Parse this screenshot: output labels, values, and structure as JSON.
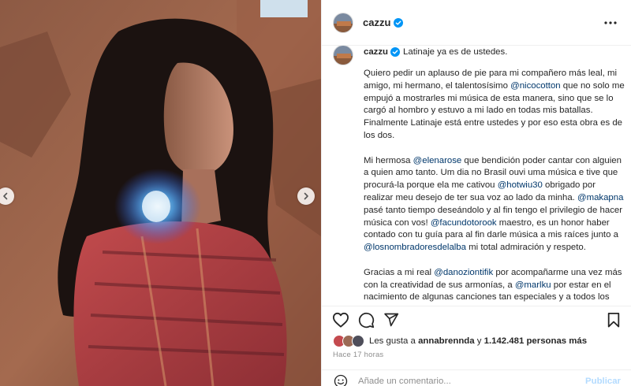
{
  "post": {
    "username": "cazzu",
    "verified": true,
    "caption_first_line": "Latinaje ya es de ustedes.",
    "caption_paragraphs": [
      [
        {
          "t": "Quiero pedir un aplauso de pie para mi compañero más leal, mi amigo, mi hermano, el talentosísimo "
        },
        {
          "m": "@nicocotton"
        },
        {
          "t": " que no solo me empujó a mostrarles mi música de esta manera, sino que se lo cargó al hombro y estuvo a mi lado en todas mis batallas. Finalmente Latinaje está entre ustedes y por eso esta obra es de los dos."
        }
      ],
      [
        {
          "t": "Mi hermosa "
        },
        {
          "m": "@elenarose"
        },
        {
          "t": " que bendición poder cantar con alguien a quien amo tanto. Um dia no Brasil ouvi uma música e tive que procurá-la porque ela me cativou "
        },
        {
          "m": "@hotwiu30"
        },
        {
          "t": " obrigado por realizar meu desejo de ter sua voz ao lado da minha. "
        },
        {
          "m": "@makapna"
        },
        {
          "t": " pasé tanto tiempo deseándolo y al fin tengo el privilegio de hacer música con vos! "
        },
        {
          "m": "@facundotorook"
        },
        {
          "t": " maestro, es un honor haber contado con tu guía para al fin darle música a mis raíces junto a "
        },
        {
          "m": "@losnombradoresdelalba"
        },
        {
          "t": " mi total admiración y respeto."
        }
      ],
      [
        {
          "t": "Gracias a mi real "
        },
        {
          "m": "@danoziontifik"
        },
        {
          "t": " por acompañarme una vez más con la creatividad de sus armonías, a "
        },
        {
          "m": "@marlku"
        },
        {
          "t": " por estar en el nacimiento de algunas canciones tan especiales y a todos los músicos que han formado parte de la construcción de Latinaje, un cariño inmenso!"
        }
      ]
    ],
    "likes": {
      "prefix": "Les gusta a ",
      "first_user": "annabrennda",
      "connector": " y ",
      "others": "1.142.481 personas más"
    },
    "time_ago": "Hace 17 horas",
    "comment_placeholder": "Añade un comentario...",
    "publish_label": "Publicar"
  },
  "icons": {
    "more": "more-options-icon",
    "like": "heart-icon",
    "comment": "comment-icon",
    "share": "share-icon",
    "save": "bookmark-icon",
    "emoji": "emoji-icon",
    "prev": "chevron-left-icon",
    "next": "chevron-right-icon",
    "verified": "verified-badge-icon"
  },
  "colors": {
    "mention": "#00376b",
    "verified": "#0095f6",
    "publish_disabled": "#b3dbff",
    "muted": "#8e8e8e"
  }
}
